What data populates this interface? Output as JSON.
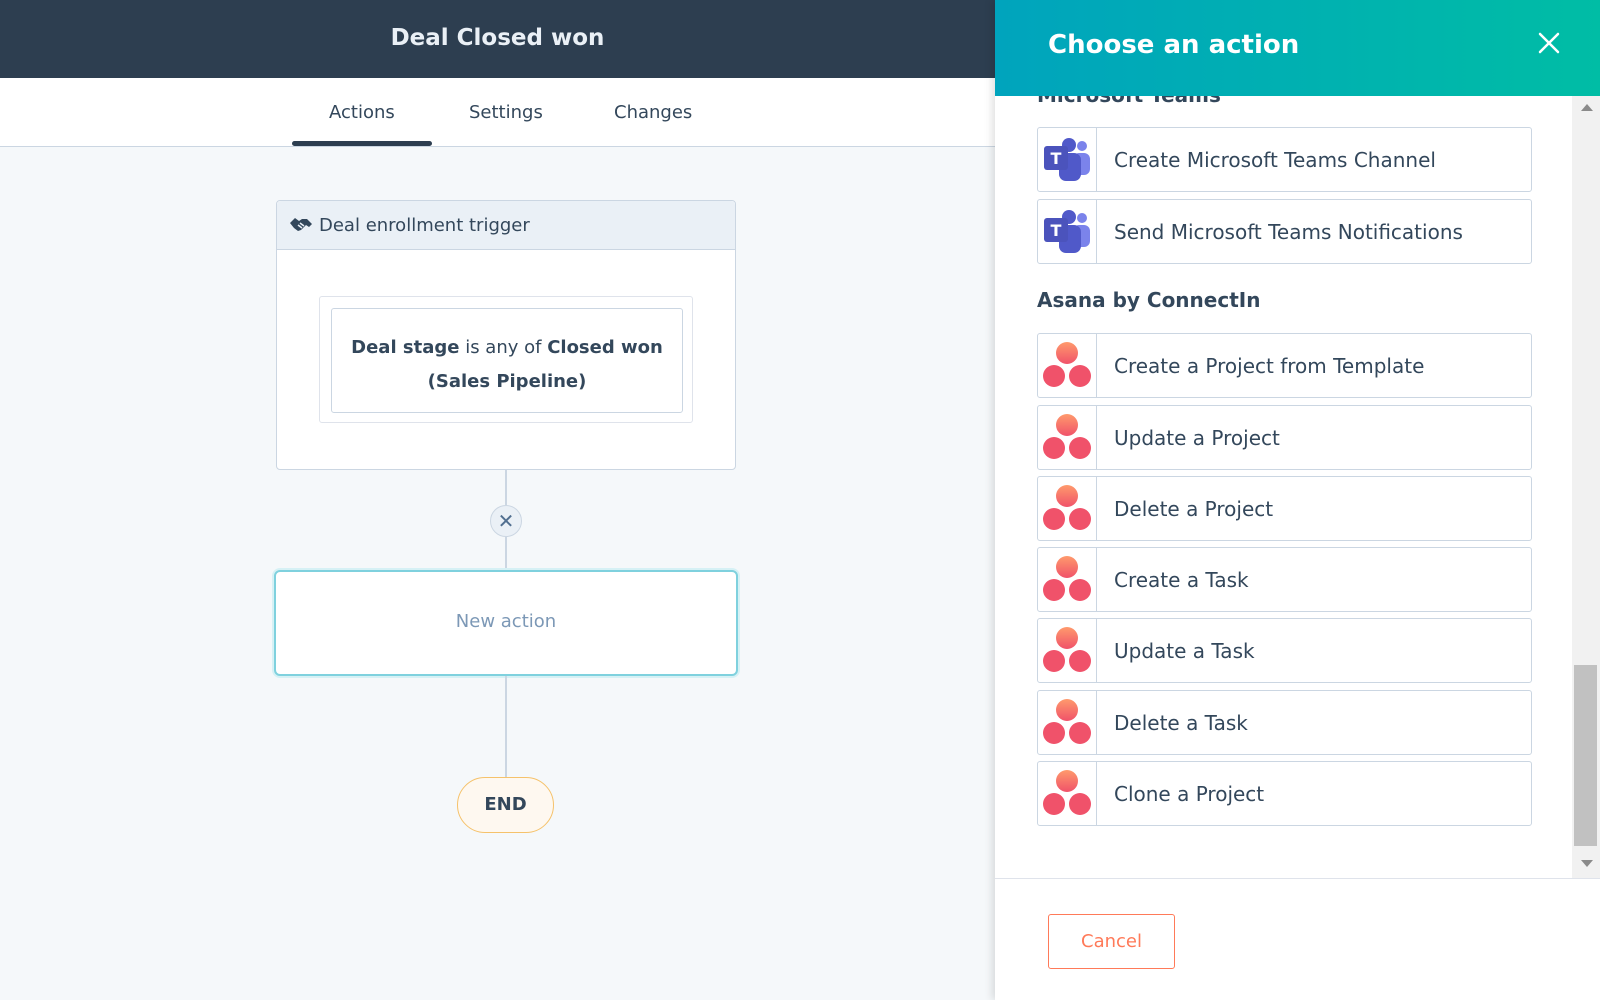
{
  "workflow": {
    "title": "Deal Closed won",
    "tabs": [
      {
        "label": "Actions",
        "active": true
      },
      {
        "label": "Settings",
        "active": false
      },
      {
        "label": "Changes",
        "active": false
      }
    ],
    "trigger": {
      "header": "Deal enrollment trigger",
      "condition": {
        "property": "Deal stage",
        "operator": "is any of",
        "value": "Closed won",
        "pipeline": "(Sales Pipeline)"
      }
    },
    "connector_icon": "close-icon",
    "new_action_label": "New action",
    "end_label": "END"
  },
  "panel": {
    "title": "Choose an action",
    "close_icon": "close-icon",
    "sections": [
      {
        "title": "Microsoft Teams",
        "icon": "microsoft-teams-icon",
        "items": [
          "Create Microsoft Teams Channel",
          "Send Microsoft Teams Notifications"
        ]
      },
      {
        "title": "Asana by ConnectIn",
        "icon": "asana-icon",
        "items": [
          "Create a Project from Template",
          "Update a Project",
          "Delete a Project",
          "Create a Task",
          "Update a Task",
          "Delete a Task",
          "Clone a Project"
        ]
      }
    ],
    "cancel_label": "Cancel"
  },
  "colors": {
    "topbar": "#2d3e50",
    "panel_header_start": "#00a4bd",
    "panel_header_end": "#00bda5",
    "cancel": "#ff7a59",
    "teams": "#5059c9",
    "asana": "#f06a6a"
  }
}
